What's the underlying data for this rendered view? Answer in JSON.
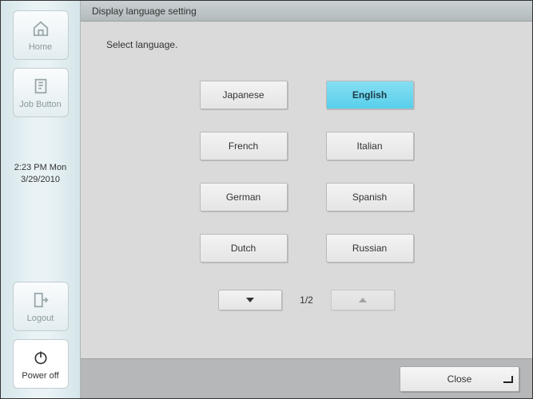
{
  "sidebar": {
    "home_label": "Home",
    "job_button_label": "Job Button",
    "time": "2:23 PM  Mon",
    "date": "3/29/2010",
    "logout_label": "Logout",
    "poweroff_label": "Power off"
  },
  "header": {
    "title": "Display language setting"
  },
  "content": {
    "prompt": "Select language."
  },
  "languages": [
    {
      "id": "japanese",
      "label": "Japanese",
      "selected": false
    },
    {
      "id": "english",
      "label": "English",
      "selected": true
    },
    {
      "id": "french",
      "label": "French",
      "selected": false
    },
    {
      "id": "italian",
      "label": "Italian",
      "selected": false
    },
    {
      "id": "german",
      "label": "German",
      "selected": false
    },
    {
      "id": "spanish",
      "label": "Spanish",
      "selected": false
    },
    {
      "id": "dutch",
      "label": "Dutch",
      "selected": false
    },
    {
      "id": "russian",
      "label": "Russian",
      "selected": false
    }
  ],
  "pager": {
    "label": "1/2",
    "next_enabled": true,
    "prev_enabled": false
  },
  "footer": {
    "close_label": "Close"
  }
}
